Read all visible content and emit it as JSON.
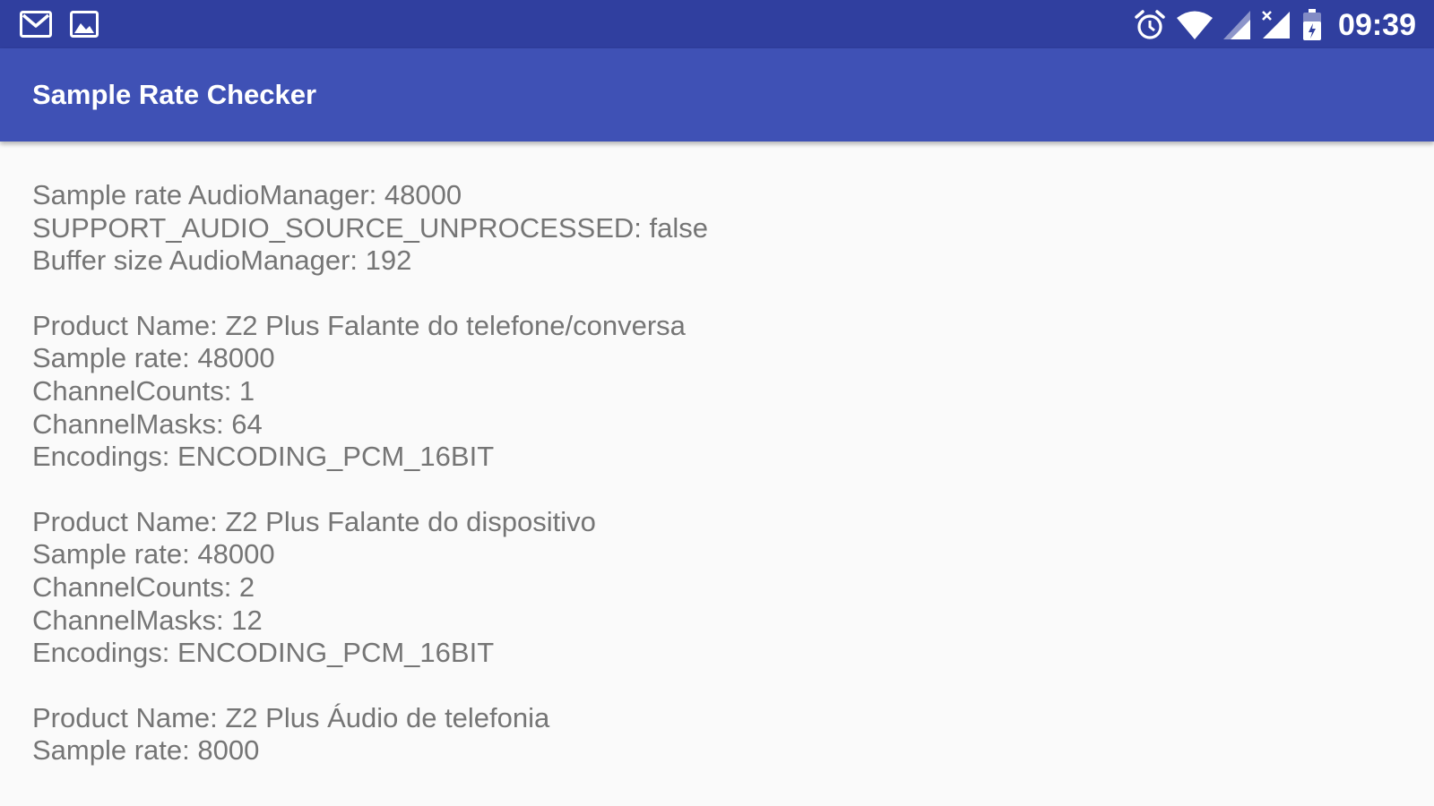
{
  "status_bar": {
    "time": "09:39",
    "icons_left": [
      "gmail-icon",
      "gallery-icon"
    ],
    "icons_right": [
      "alarm-icon",
      "wifi-icon",
      "signal-icon",
      "signal-no-service-icon",
      "battery-icon"
    ]
  },
  "app_bar": {
    "title": "Sample Rate Checker"
  },
  "content": {
    "blocks": [
      {
        "lines": [
          "Sample rate AudioManager: 48000",
          "SUPPORT_AUDIO_SOURCE_UNPROCESSED: false",
          "Buffer size AudioManager: 192"
        ]
      },
      {
        "lines": [
          "Product Name: Z2 Plus Falante do telefone/conversa",
          "Sample rate: 48000",
          "ChannelCounts: 1",
          "ChannelMasks: 64",
          "Encodings: ENCODING_PCM_16BIT"
        ]
      },
      {
        "lines": [
          "Product Name: Z2 Plus Falante do dispositivo",
          "Sample rate: 48000",
          "ChannelCounts: 2",
          "ChannelMasks: 12",
          "Encodings: ENCODING_PCM_16BIT"
        ]
      },
      {
        "lines": [
          "Product Name: Z2 Plus Áudio de telefonia",
          "Sample rate: 8000"
        ]
      }
    ]
  },
  "colors": {
    "status_bar": "#303f9f",
    "app_bar": "#3f51b5",
    "background": "#fafafa",
    "text": "#757575"
  }
}
